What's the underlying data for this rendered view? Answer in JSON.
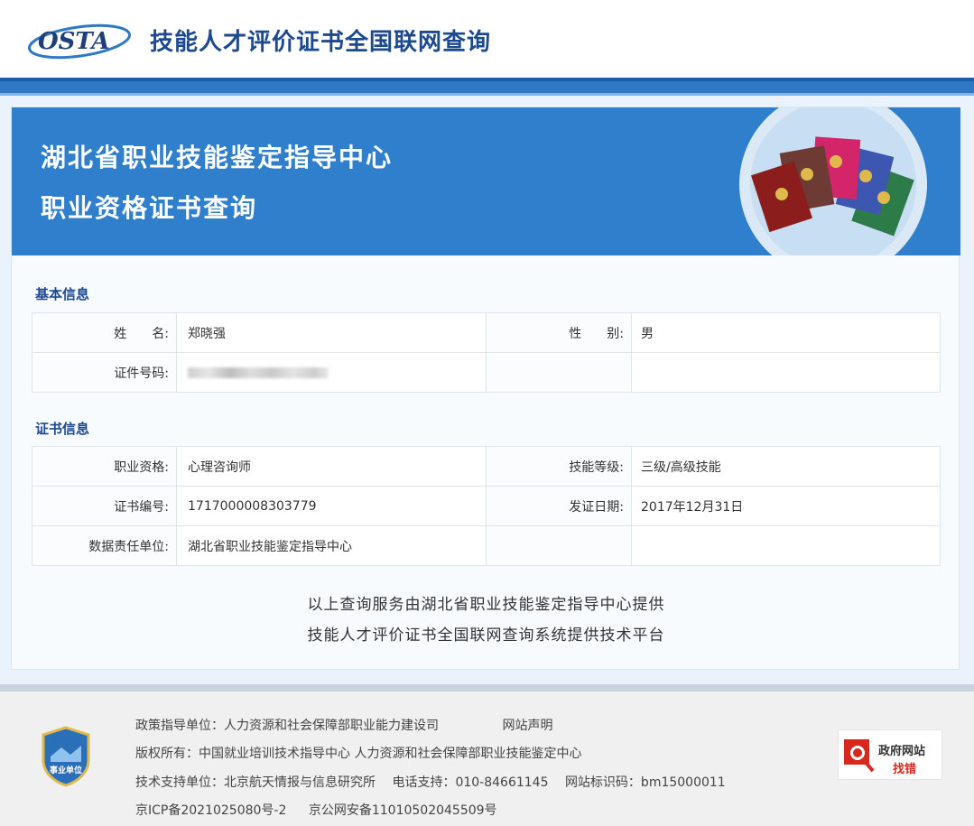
{
  "header": {
    "logo_text": "OSTA",
    "site_title": "技能人才评价证书全国联网查询"
  },
  "banner": {
    "title_line1": "湖北省职业技能鉴定指导中心",
    "title_line2": "职业资格证书查询"
  },
  "basic_info": {
    "section_title": "基本信息",
    "name_label": "姓　　名:",
    "name_value": "郑晓强",
    "gender_label": "性　　别:",
    "gender_value": "男",
    "id_label": "证件号码:",
    "id_value_redacted": true
  },
  "certificate_info": {
    "section_title": "证书信息",
    "qualification_label": "职业资格:",
    "qualification_value": "心理咨询师",
    "level_label": "技能等级:",
    "level_value": "三级/高级技能",
    "cert_no_label": "证书编号:",
    "cert_no_value": "1717000008303779",
    "issue_date_label": "发证日期:",
    "issue_date_value": "2017年12月31日",
    "unit_label": "数据责任单位:",
    "unit_value": "湖北省职业技能鉴定指导中心"
  },
  "credits": {
    "line1": "以上查询服务由湖北省职业技能鉴定指导中心提供",
    "line2": "技能人才评价证书全国联网查询系统提供技术平台"
  },
  "footer": {
    "badge_text": "事业单位",
    "policy": "政策指导单位：人力资源和社会保障部职业能力建设司",
    "site_statement": "网站声明",
    "copyright": "版权所有：中国就业培训技术指导中心 人力资源和社会保障部职业技能鉴定中心",
    "tech_support": "技术支持单位：北京航天情报与信息研究所",
    "phone": "电话支持：010-84661145",
    "site_code": "网站标识码：bm15000011",
    "icp": "京ICP备2021025080号-2",
    "police": "京公网安备11010502045509号",
    "gov_badge_line1": "政府网站",
    "gov_badge_line2": "找错"
  },
  "colors": {
    "brand_blue": "#2f7fcc",
    "title_blue": "#1d4a8f",
    "gov_red": "#d6281f"
  }
}
